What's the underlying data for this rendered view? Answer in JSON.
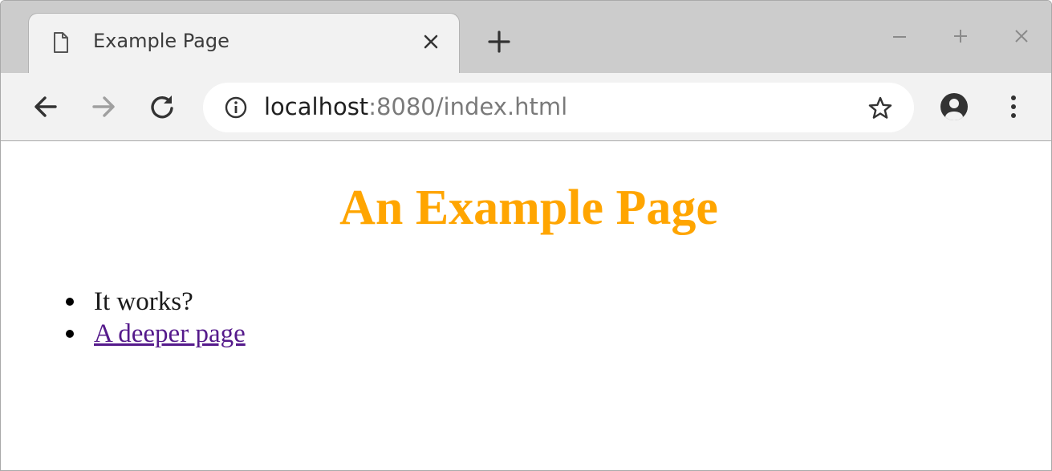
{
  "browser": {
    "tab": {
      "title": "Example Page",
      "icon": "page-icon"
    },
    "new_tab_icon": "plus-icon",
    "window_controls": [
      "minimize-icon",
      "maximize-icon",
      "close-icon"
    ],
    "toolbar": {
      "back_icon": "arrow-left-icon",
      "forward_icon": "arrow-right-icon",
      "reload_icon": "reload-icon",
      "site_info_icon": "info-icon",
      "bookmark_icon": "star-icon",
      "profile_icon": "account-icon",
      "menu_icon": "kebab-menu-icon"
    },
    "address_bar": {
      "host": "localhost",
      "rest": ":8080/index.html"
    }
  },
  "page": {
    "heading": "An Example Page",
    "list": [
      {
        "text": "It works?"
      },
      {
        "text": "A deeper page"
      }
    ]
  },
  "colors": {
    "heading": "#ffa500",
    "link_visited": "#551a8b",
    "chrome_frame": "#cccccc",
    "chrome_toolbar": "#f2f2f2"
  }
}
